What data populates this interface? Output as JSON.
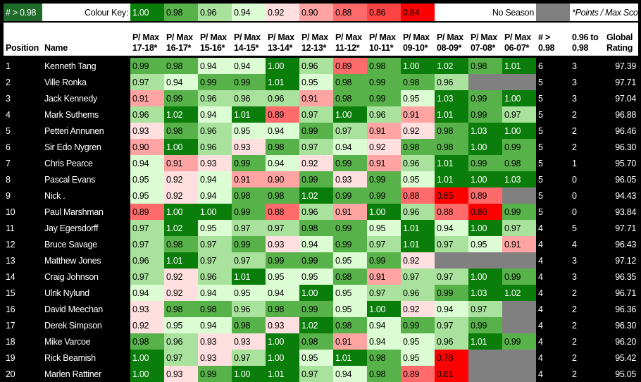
{
  "key": {
    "threshold_label": "# > 0.98",
    "colour_key_label": "Colour Key:",
    "levels": [
      {
        "label": "1.00",
        "color": "#0b7d0b"
      },
      {
        "label": "0.98",
        "color": "#58b24a"
      },
      {
        "label": "0.96",
        "color": "#a9e29c"
      },
      {
        "label": "0.94",
        "color": "#dcfcd3"
      },
      {
        "label": "0.92",
        "color": "#ffdfdf"
      },
      {
        "label": "0.90",
        "color": "#ffa3a3"
      },
      {
        "label": "0.88",
        "color": "#ff6b6b"
      },
      {
        "label": "0.86",
        "color": "#ff4444"
      },
      {
        "label": "0.84",
        "color": "#ff0000"
      }
    ],
    "no_season_label": "No Season",
    "no_season_color": "#808080",
    "note": "*Points / Max Score"
  },
  "headers": {
    "position": "Position",
    "name": "Name",
    "seasons": [
      "P/ Max 17-18*",
      "P/ Max 16-17*",
      "P/ Max 15-16*",
      "P/ Max 14-15*",
      "P/ Max 13-14*",
      "P/ Max 12-13*",
      "P/ Max 11-12*",
      "P/ Max 10-11*",
      "P/ Max 09-10*",
      "P/ Max 08-09*",
      "P/ Max 07-08*",
      "P/ Max 06-07*"
    ],
    "above": "# > 0.98",
    "between": "0.96 to 0.98",
    "global": "Global Rating"
  },
  "rows": [
    {
      "pos": "1",
      "name": "Kenneth Tang",
      "v": [
        "0.99",
        "0.98",
        "0.94",
        "0.94",
        "1.00",
        "0.96",
        "0.89",
        "0.98",
        "1.00",
        "1.02",
        "0.98",
        "1.01"
      ],
      "above": "6",
      "between": "3",
      "global": "97.39"
    },
    {
      "pos": "2",
      "name": "Ville Ronka",
      "v": [
        "0.97",
        "0.94",
        "0.99",
        "0.99",
        "1.01",
        "0.95",
        "0.98",
        "0.99",
        "0.98",
        "0.96",
        null,
        null
      ],
      "above": "5",
      "between": "3",
      "global": "97.71"
    },
    {
      "pos": "3",
      "name": "Jack Kennedy",
      "v": [
        "0.91",
        "0.99",
        "0.96",
        "0.96",
        "0.96",
        "0.91",
        "0.98",
        "0.99",
        "0.95",
        "1.03",
        "0.99",
        "1.00"
      ],
      "above": "5",
      "between": "3",
      "global": "97.04"
    },
    {
      "pos": "4",
      "name": "Mark Suthems",
      "v": [
        "0.96",
        "1.02",
        "0.94",
        "1.01",
        "0.89",
        "0.97",
        "1.00",
        "0.96",
        "0.91",
        "1.01",
        "0.99",
        "0.97"
      ],
      "above": "5",
      "between": "2",
      "global": "96.88"
    },
    {
      "pos": "5",
      "name": "Petteri Annunen",
      "v": [
        "0.93",
        "0.98",
        "0.96",
        "0.95",
        "0.94",
        "0.99",
        "0.97",
        "0.91",
        "0.92",
        "0.98",
        "1.03",
        "1.00"
      ],
      "above": "5",
      "between": "2",
      "global": "96.46"
    },
    {
      "pos": "6",
      "name": "Sir Edo Nygren",
      "v": [
        "0.90",
        "1.00",
        "0.96",
        "0.93",
        "0.98",
        "0.97",
        "0.94",
        "0.92",
        "0.98",
        "0.98",
        "1.00",
        "0.99"
      ],
      "above": "5",
      "between": "2",
      "global": "96.30"
    },
    {
      "pos": "7",
      "name": "Chris Pearce",
      "v": [
        "0.94",
        "0.91",
        "0.93",
        "0.99",
        "0.94",
        "0.92",
        "0.99",
        "0.91",
        "0.96",
        "1.01",
        "0.99",
        "0.98"
      ],
      "above": "5",
      "between": "1",
      "global": "95.70"
    },
    {
      "pos": "8",
      "name": "Pascal Evans",
      "v": [
        "0.95",
        "0.92",
        "0.94",
        "0.91",
        "0.90",
        "0.99",
        "0.93",
        "0.99",
        "0.95",
        "1.01",
        "1.00",
        "1.03"
      ],
      "above": "5",
      "between": "0",
      "global": "96.05"
    },
    {
      "pos": "9",
      "name": "Nick .",
      "v": [
        "0.95",
        "0.92",
        "0.94",
        "0.98",
        "0.98",
        "1.02",
        "0.99",
        "0.99",
        "0.88",
        "0.85",
        "0.89",
        null
      ],
      "above": "5",
      "between": "0",
      "global": "94.43"
    },
    {
      "pos": "10",
      "name": "Paul Marshman",
      "v": [
        "0.89",
        "1.00",
        "1.00",
        "0.99",
        "0.88",
        "0.96",
        "0.91",
        "1.00",
        "0.96",
        "0.88",
        "0.80",
        "0.99"
      ],
      "above": "5",
      "between": "0",
      "global": "93.84"
    },
    {
      "pos": "11",
      "name": "Jay Egersdorff",
      "v": [
        "0.97",
        "1.02",
        "0.95",
        "0.97",
        "0.97",
        "0.98",
        "0.99",
        "0.95",
        "1.01",
        "0.94",
        "1.00",
        "0.97"
      ],
      "above": "4",
      "between": "5",
      "global": "97.71"
    },
    {
      "pos": "12",
      "name": "Bruce Savage",
      "v": [
        "0.97",
        "0.98",
        "0.97",
        "0.99",
        "0.93",
        "0.94",
        "0.99",
        "0.97",
        "1.01",
        "0.97",
        "0.95",
        "0.91"
      ],
      "above": "4",
      "between": "4",
      "global": "96.43"
    },
    {
      "pos": "13",
      "name": "Matthew Jones",
      "v": [
        "0.96",
        "1.01",
        "0.97",
        "0.97",
        "0.99",
        "0.99",
        "0.95",
        "0.99",
        "0.92",
        null,
        null,
        null
      ],
      "above": "4",
      "between": "3",
      "global": "97.12"
    },
    {
      "pos": "14",
      "name": "Craig Johnson",
      "v": [
        "0.97",
        "0.92",
        "0.96",
        "1.01",
        "0.95",
        "0.95",
        "0.98",
        "0.91",
        "0.97",
        "0.97",
        "1.00",
        "0.99"
      ],
      "above": "4",
      "between": "3",
      "global": "96.35"
    },
    {
      "pos": "15",
      "name": "Ulrik Nylund",
      "v": [
        "0.94",
        "0.92",
        "0.94",
        "0.95",
        "0.94",
        "1.00",
        "0.95",
        "0.97",
        "0.96",
        "0.99",
        "1.03",
        "1.02"
      ],
      "above": "4",
      "between": "2",
      "global": "96.71"
    },
    {
      "pos": "16",
      "name": "David Meechan",
      "v": [
        "0.93",
        "0.98",
        "0.98",
        "0.96",
        "0.98",
        "0.99",
        "0.95",
        "1.00",
        "0.92",
        "0.94",
        "0.97",
        null
      ],
      "above": "4",
      "between": "2",
      "global": "96.36"
    },
    {
      "pos": "17",
      "name": "Derek Simpson",
      "v": [
        "0.92",
        "0.95",
        "0.94",
        "0.98",
        "0.93",
        "1.02",
        "0.98",
        "0.94",
        "0.99",
        "0.97",
        "0.99",
        null
      ],
      "above": "4",
      "between": "2",
      "global": "96.30"
    },
    {
      "pos": "18",
      "name": "Mike Varcoe",
      "v": [
        "0.98",
        "0.96",
        "0.93",
        "0.93",
        "1.00",
        "0.98",
        "0.91",
        "0.94",
        "0.95",
        "0.96",
        "1.01",
        "0.99"
      ],
      "above": "4",
      "between": "2",
      "global": "96.20"
    },
    {
      "pos": "19",
      "name": "Rick Beamish",
      "v": [
        "1.00",
        "0.97",
        "0.93",
        "0.97",
        "1.00",
        "0.95",
        "1.01",
        "0.98",
        "0.95",
        "0.78",
        null,
        null
      ],
      "above": "4",
      "between": "2",
      "global": "95.42"
    },
    {
      "pos": "20",
      "name": "Marlen Rattiner",
      "v": [
        "1.00",
        "0.93",
        "0.99",
        "1.00",
        "1.01",
        "0.97",
        "0.94",
        "0.98",
        "0.89",
        "0.81",
        null,
        null
      ],
      "above": "4",
      "between": "2",
      "global": "95.05"
    }
  ]
}
